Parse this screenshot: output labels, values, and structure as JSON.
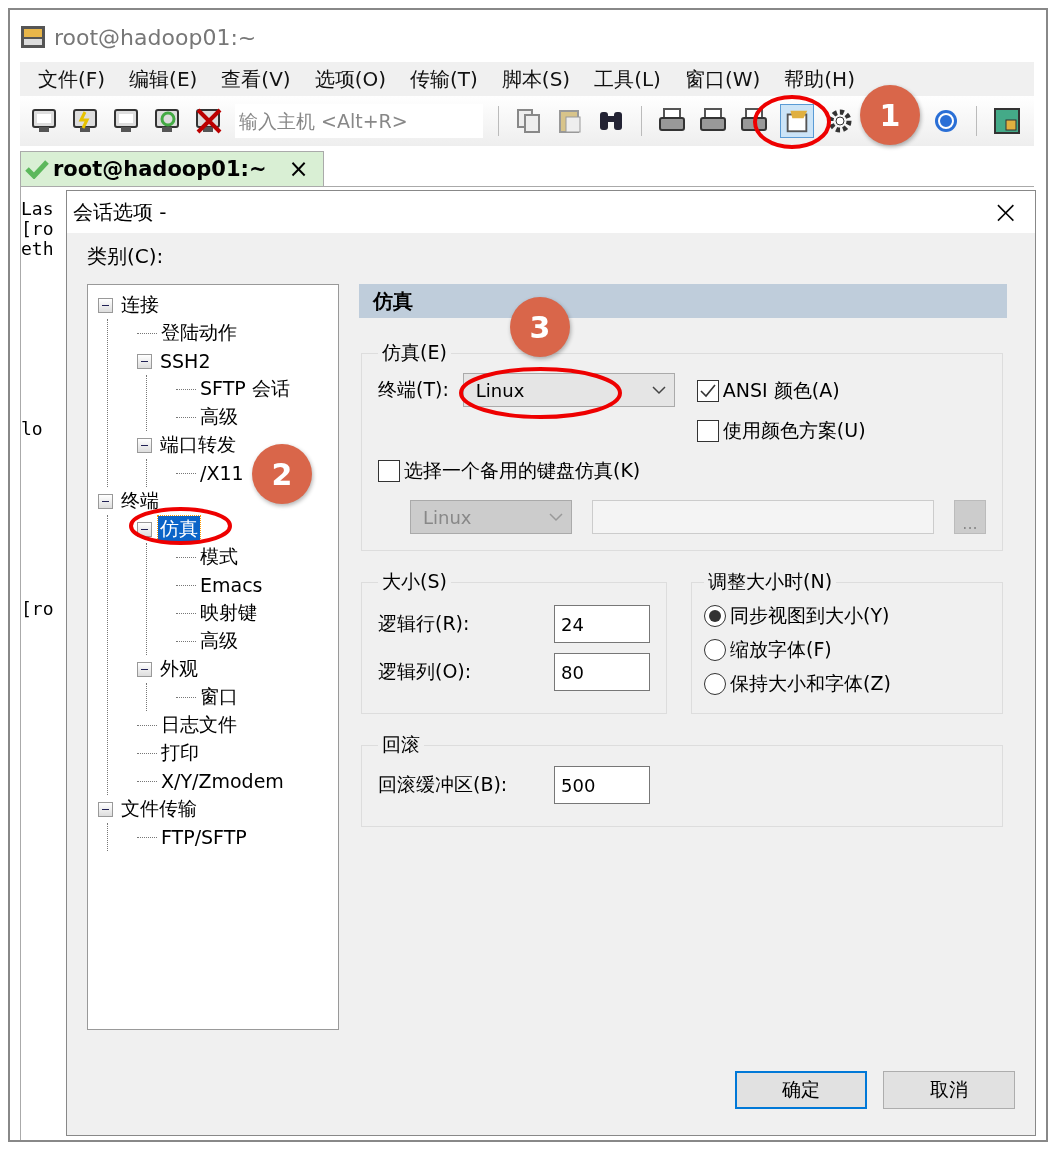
{
  "window": {
    "title": "root@hadoop01:~"
  },
  "menu": [
    "文件(F)",
    "编辑(E)",
    "查看(V)",
    "选项(O)",
    "传输(T)",
    "脚本(S)",
    "工具(L)",
    "窗口(W)",
    "帮助(H)"
  ],
  "toolbar": {
    "host_placeholder": "输入主机 <Alt+R>",
    "session_options_pressed": true
  },
  "tabs": [
    {
      "label": "root@hadoop01:~",
      "selected": true,
      "close": "×"
    }
  ],
  "terminal": {
    "lines": [
      "Las",
      "[ro",
      "eth",
      "lo",
      "[ro"
    ]
  },
  "dialog": {
    "title": "会话选项 -",
    "close": "×",
    "category_label": "类别(C):",
    "tree": [
      {
        "label": "连接",
        "selected": false,
        "expanded": true,
        "children": [
          {
            "label": "登陆动作",
            "selected": false
          },
          {
            "label": "SSH2",
            "selected": false,
            "expanded": true,
            "children": [
              {
                "label": "SFTP 会话",
                "selected": false
              },
              {
                "label": "高级",
                "selected": false
              }
            ]
          },
          {
            "label": "端口转发",
            "selected": false,
            "expanded": true,
            "children": [
              {
                "label": "/X11",
                "selected": false
              }
            ]
          }
        ]
      },
      {
        "label": "终端",
        "selected": false,
        "expanded": true,
        "children": [
          {
            "label": "仿真",
            "selected": true,
            "expanded": true,
            "children": [
              {
                "label": "模式",
                "selected": false
              },
              {
                "label": "Emacs",
                "selected": false
              },
              {
                "label": "映射键",
                "selected": false
              },
              {
                "label": "高级",
                "selected": false
              }
            ]
          },
          {
            "label": "外观",
            "selected": false,
            "expanded": true,
            "children": [
              {
                "label": "窗口",
                "selected": false
              }
            ]
          },
          {
            "label": "日志文件",
            "selected": false
          },
          {
            "label": "打印",
            "selected": false
          },
          {
            "label": "X/Y/Zmodem",
            "selected": false
          }
        ]
      },
      {
        "label": "文件传输",
        "selected": false,
        "expanded": true,
        "children": [
          {
            "label": "FTP/SFTP",
            "selected": false
          }
        ]
      }
    ],
    "panel_title": "仿真",
    "emulation": {
      "legend": "仿真(E)",
      "terminal_label": "终端(T):",
      "terminal_value": "Linux",
      "checkboxes": [
        {
          "label": "ANSI 颜色(A)",
          "checked": true
        },
        {
          "label": "使用颜色方案(U)",
          "checked": false
        }
      ],
      "alt_keyboard": {
        "label": "选择一个备用的键盘仿真(K)",
        "checked": false,
        "select_value": "Linux",
        "browse": "..."
      }
    },
    "size": {
      "legend": "大小(S)",
      "fields": [
        {
          "label": "逻辑行(R):",
          "value": "24"
        },
        {
          "label": "逻辑列(O):",
          "value": "80"
        }
      ]
    },
    "resize": {
      "legend": "调整大小时(N)",
      "options": [
        {
          "label": "同步视图到大小(Y)",
          "selected": true
        },
        {
          "label": "缩放字体(F)",
          "selected": false
        },
        {
          "label": "保持大小和字体(Z)",
          "selected": false
        }
      ]
    },
    "scrollback": {
      "legend": "回滚",
      "label": "回滚缓冲区(B):",
      "value": "500"
    },
    "buttons": [
      {
        "label": "确定",
        "default": true
      },
      {
        "label": "取消",
        "default": false
      }
    ]
  },
  "annotations": [
    "1",
    "2",
    "3"
  ]
}
